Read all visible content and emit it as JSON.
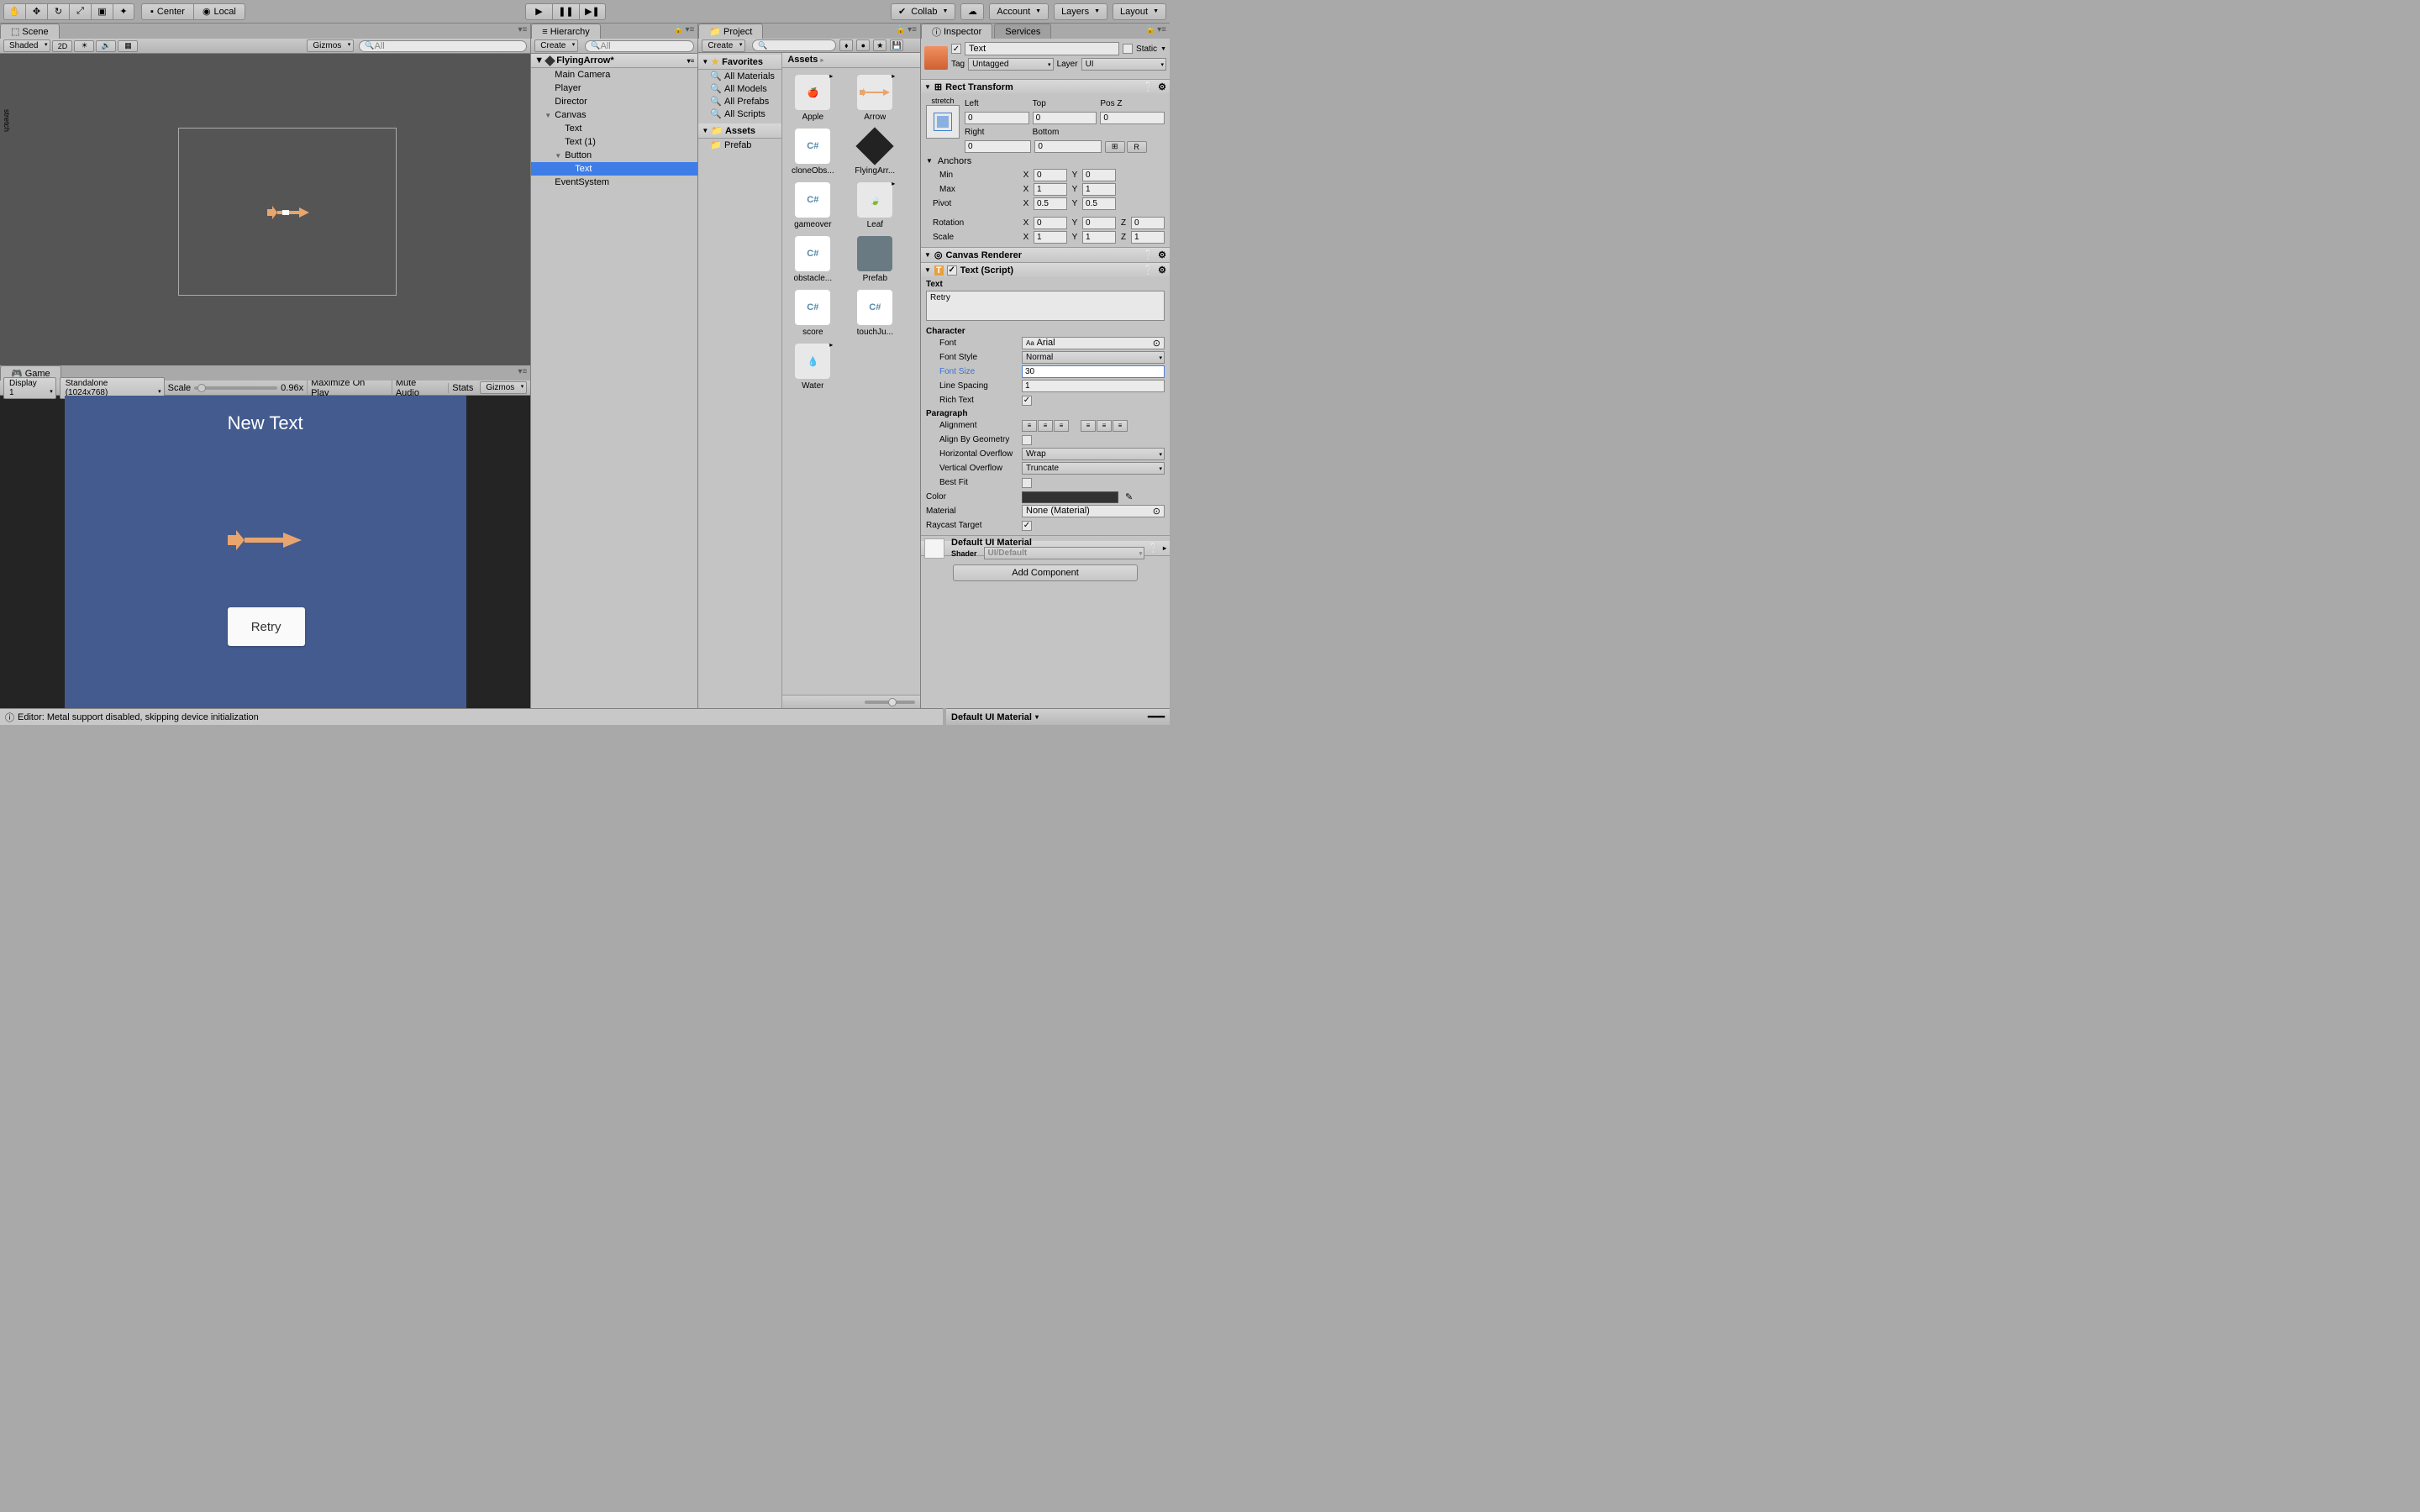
{
  "toolbar": {
    "center": "Center",
    "local": "Local",
    "collab": "Collab",
    "account": "Account",
    "layers": "Layers",
    "layout": "Layout"
  },
  "scene": {
    "tab": "Scene",
    "shading": "Shaded",
    "mode2d": "2D",
    "gizmos": "Gizmos",
    "search_placeholder": "All"
  },
  "game": {
    "tab": "Game",
    "display": "Display 1",
    "resolution": "Standalone (1024x768)",
    "scale": "Scale",
    "scale_value": "0.96x",
    "maximize": "Maximize On Play",
    "mute": "Mute Audio",
    "stats": "Stats",
    "gizmos": "Gizmos",
    "new_text": "New Text",
    "retry": "Retry"
  },
  "hierarchy": {
    "tab": "Hierarchy",
    "create": "Create",
    "search_placeholder": "All",
    "scene": "FlyingArrow*",
    "items": [
      "Main Camera",
      "Player",
      "Director",
      "Canvas",
      "Text",
      "Text (1)",
      "Button",
      "Text",
      "EventSystem"
    ]
  },
  "project": {
    "tab": "Project",
    "create": "Create",
    "favorites": "Favorites",
    "fav_items": [
      "All Materials",
      "All Models",
      "All Prefabs",
      "All Scripts"
    ],
    "assets": "Assets",
    "prefab_folder": "Prefab",
    "breadcrumb": "Assets",
    "grid": [
      "Apple",
      "Arrow",
      "cloneObs...",
      "FlyingArr...",
      "gameover",
      "Leaf",
      "obstacle...",
      "Prefab",
      "score",
      "touchJu...",
      "Water"
    ]
  },
  "inspector": {
    "tab": "Inspector",
    "services_tab": "Services",
    "name": "Text",
    "static": "Static",
    "tag_label": "Tag",
    "tag": "Untagged",
    "layer_label": "Layer",
    "layer": "UI",
    "rect_transform": {
      "title": "Rect Transform",
      "stretch": "stretch",
      "left": "Left",
      "top": "Top",
      "posz": "Pos Z",
      "left_v": "0",
      "top_v": "0",
      "posz_v": "0",
      "right": "Right",
      "bottom": "Bottom",
      "right_v": "0",
      "bottom_v": "0",
      "anchors": "Anchors",
      "min": "Min",
      "min_x": "0",
      "min_y": "0",
      "max": "Max",
      "max_x": "1",
      "max_y": "1",
      "pivot": "Pivot",
      "pivot_x": "0.5",
      "pivot_y": "0.5",
      "rotation": "Rotation",
      "rot_x": "0",
      "rot_y": "0",
      "rot_z": "0",
      "scale": "Scale",
      "scale_x": "1",
      "scale_y": "1",
      "scale_z": "1"
    },
    "canvas_renderer": "Canvas Renderer",
    "text_comp": {
      "title": "Text (Script)",
      "text_label": "Text",
      "text_value": "Retry",
      "character": "Character",
      "font": "Font",
      "font_v": "Arial",
      "font_style": "Font Style",
      "font_style_v": "Normal",
      "font_size": "Font Size",
      "font_size_v": "30",
      "line_spacing": "Line Spacing",
      "line_spacing_v": "1",
      "rich_text": "Rich Text",
      "paragraph": "Paragraph",
      "alignment": "Alignment",
      "align_geom": "Align By Geometry",
      "h_overflow": "Horizontal Overflow",
      "h_overflow_v": "Wrap",
      "v_overflow": "Vertical Overflow",
      "v_overflow_v": "Truncate",
      "best_fit": "Best Fit",
      "color": "Color",
      "material": "Material",
      "material_v": "None (Material)",
      "raycast": "Raycast Target"
    },
    "default_mat": "Default UI Material",
    "shader": "Shader",
    "shader_v": "UI/Default",
    "add_component": "Add Component"
  },
  "status": "Editor: Metal support disabled, skipping device initialization",
  "status_right": "Default UI Material"
}
